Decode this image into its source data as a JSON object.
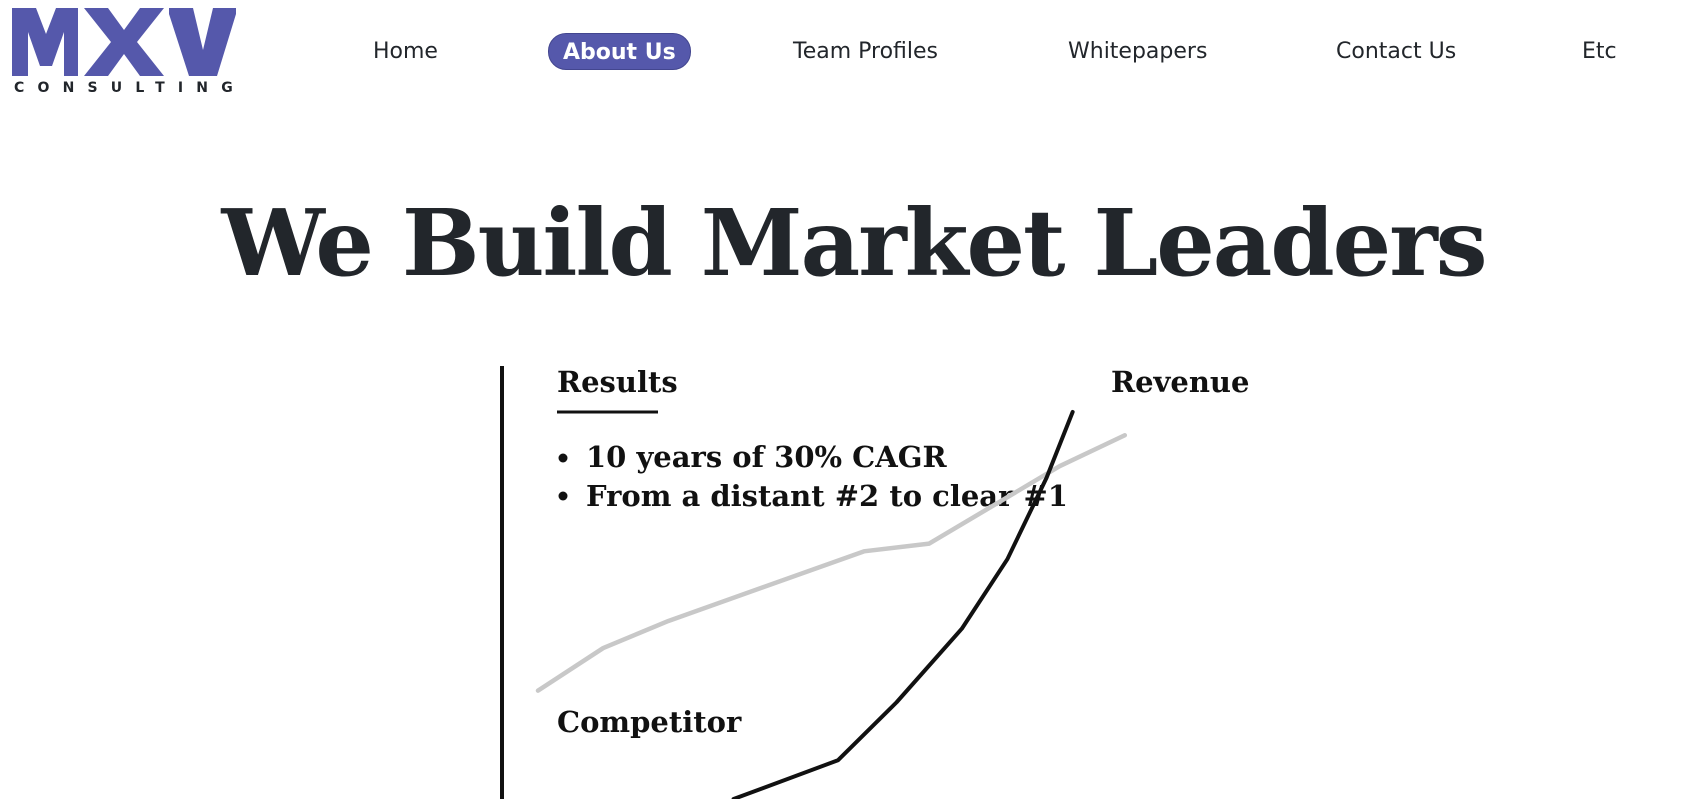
{
  "brand": {
    "logo_text": "MXV",
    "tagline": "CONSULTING",
    "logo_color": "#5558ab"
  },
  "nav": {
    "items": [
      {
        "label": "Home",
        "active": false
      },
      {
        "label": "About Us",
        "active": true
      },
      {
        "label": "Team Profiles",
        "active": false
      },
      {
        "label": "Whitepapers",
        "active": false
      },
      {
        "label": "Contact Us",
        "active": false
      },
      {
        "label": "Etc",
        "active": false
      }
    ],
    "active_color": "#5558ab"
  },
  "hero": {
    "title": "We Build Market Leaders"
  },
  "chart_data": {
    "type": "line",
    "title": "Results",
    "bullets": [
      "10 years of 30% CAGR",
      "From a distant #2 to clear #1"
    ],
    "grid": false,
    "series": [
      {
        "name": "Revenue",
        "color": "#111111",
        "points": [
          [
            0.3,
            0.0
          ],
          [
            0.46,
            0.1
          ],
          [
            0.55,
            0.25
          ],
          [
            0.65,
            0.44
          ],
          [
            0.72,
            0.62
          ],
          [
            0.78,
            0.83
          ],
          [
            0.82,
            1.0
          ]
        ]
      },
      {
        "name": "Competitor",
        "color": "#c8c8c8",
        "points": [
          [
            0.0,
            0.28
          ],
          [
            0.1,
            0.39
          ],
          [
            0.2,
            0.46
          ],
          [
            0.5,
            0.64
          ],
          [
            0.6,
            0.66
          ],
          [
            0.8,
            0.86
          ],
          [
            0.9,
            0.94
          ]
        ]
      }
    ]
  }
}
